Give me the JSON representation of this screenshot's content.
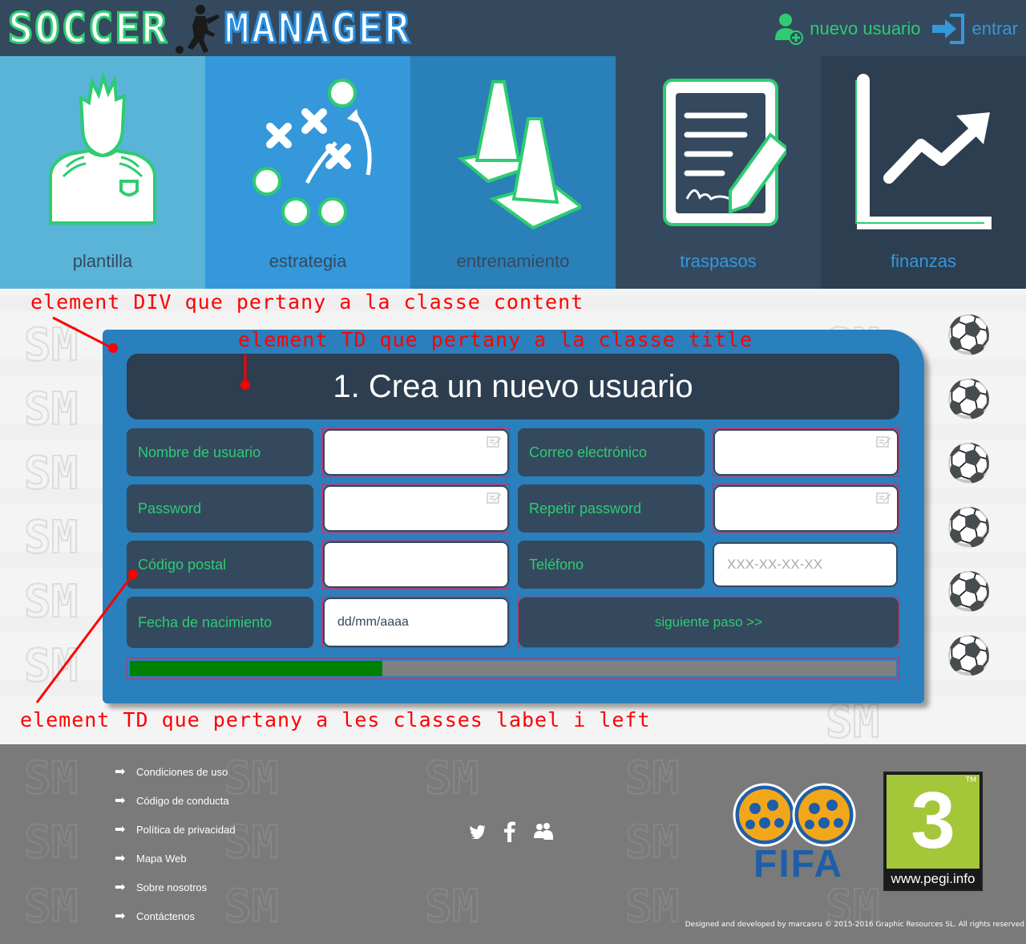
{
  "header": {
    "logo_left": "SOCCER",
    "logo_right": "MANAGER",
    "new_user_label": "nuevo usuario",
    "login_label": "entrar"
  },
  "menu": {
    "items": [
      {
        "label": "plantilla",
        "icon": "player-icon",
        "bg": "#5ab4d8",
        "color": "#34495e"
      },
      {
        "label": "estrategia",
        "icon": "strategy-icon",
        "bg": "#3498db",
        "color": "#34495e"
      },
      {
        "label": "entrenamiento",
        "icon": "cones-icon",
        "bg": "#2a80b9",
        "color": "#34495e"
      },
      {
        "label": "traspasos",
        "icon": "contract-icon",
        "bg": "#34495e",
        "color": "#3498db"
      },
      {
        "label": "finanzas",
        "icon": "chart-icon",
        "bg": "#2c3e50",
        "color": "#3498db"
      }
    ]
  },
  "annotations": {
    "content_div": "element DIV que pertany a la classe content",
    "title_td": "element TD que pertany a la classe title",
    "label_td": "element TD que pertany a les classes label i left"
  },
  "form": {
    "title": "1. Crea un nuevo usuario",
    "fields": {
      "username_label": "Nombre de usuario",
      "email_label": "Correo electrónico",
      "password_label": "Password",
      "repeat_password_label": "Repetir password",
      "postal_label": "Código postal",
      "phone_label": "Teléfono",
      "phone_placeholder": "XXX-XX-XX-XX",
      "birth_label": "Fecha de nacimiento",
      "birth_value": "dd/mm/aaaa"
    },
    "next_button": "siguiente paso >>",
    "progress": 0.33
  },
  "footer": {
    "links": [
      "Condiciones de uso",
      "Código de conducta",
      "Política de privacidad",
      "Mapa Web",
      "Sobre nosotros",
      "Contáctenos"
    ],
    "social": [
      "twitter-icon",
      "facebook-icon",
      "messenger-icon"
    ],
    "fifa_label": "FIFA",
    "pegi_rating": "3",
    "pegi_tm": "TM",
    "pegi_url": "www.pegi.info",
    "credits": "Designed and developed by marcasru © 2015-2016 Graphic Resources SL. All rights reserved"
  },
  "colors": {
    "accent_green": "#2ecc71",
    "accent_blue": "#3498db",
    "dark": "#34495e",
    "progress_fill": "#008000",
    "annotation": "#ff0000"
  }
}
